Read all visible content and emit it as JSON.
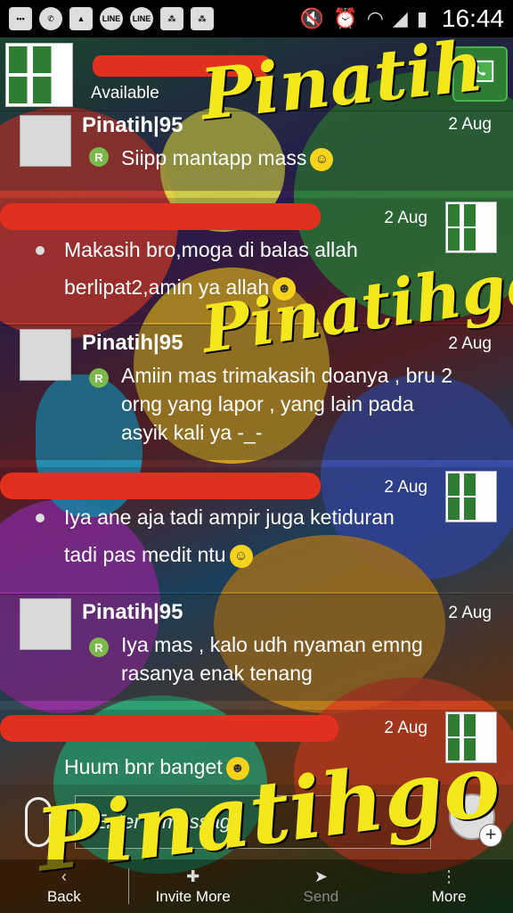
{
  "status_bar": {
    "time": "16:44",
    "notification_icons": [
      "chat-bubble-icon",
      "whatsapp-icon",
      "image-icon",
      "line-icon",
      "line-icon",
      "blackberry-icon",
      "blackberry-icon"
    ],
    "system_icons": [
      "mute-icon",
      "alarm-icon",
      "wifi-icon",
      "signal-icon",
      "battery-icon"
    ]
  },
  "header": {
    "contact_status": "Available",
    "call_button_icon": "phone-icon"
  },
  "messages": [
    {
      "direction": "in",
      "sender": "Pinatih|95",
      "date": "2 Aug",
      "text": "Siipp mantapp mass",
      "emoji": "smile"
    },
    {
      "direction": "out",
      "sender": "",
      "date": "2 Aug",
      "text_lines": [
        "Makasih bro,moga di balas allah",
        "berlipat2,amin ya allah"
      ],
      "emoji": "grin"
    },
    {
      "direction": "in",
      "sender": "Pinatih|95",
      "date": "2 Aug",
      "text_lines": [
        "Amiin mas trimakasih doanya , bru 2",
        "orng yang lapor , yang lain pada",
        "asyik kali ya -_-"
      ]
    },
    {
      "direction": "out",
      "sender": "",
      "date": "2 Aug",
      "text_lines": [
        "Iya ane aja tadi ampir juga ketiduran",
        "tadi pas medit ntu"
      ],
      "emoji": "laugh"
    },
    {
      "direction": "in",
      "sender": "Pinatih|95",
      "date": "2 Aug",
      "text_lines": [
        "Iya mas , kalo udh nyaman emng",
        "rasanya enak tenang"
      ]
    },
    {
      "direction": "out",
      "sender": "",
      "date": "2 Aug",
      "text": "Huum bnr banget",
      "emoji": "grin"
    }
  ],
  "input": {
    "placeholder": "Enter a message"
  },
  "bottom_bar": {
    "back": "Back",
    "invite_more": "Invite More",
    "send": "Send",
    "more": "More"
  },
  "read_marker": "R",
  "colors": {
    "redaction": "#e1301e",
    "scribble": "#f4e81c",
    "read_badge": "#7ab94a"
  }
}
